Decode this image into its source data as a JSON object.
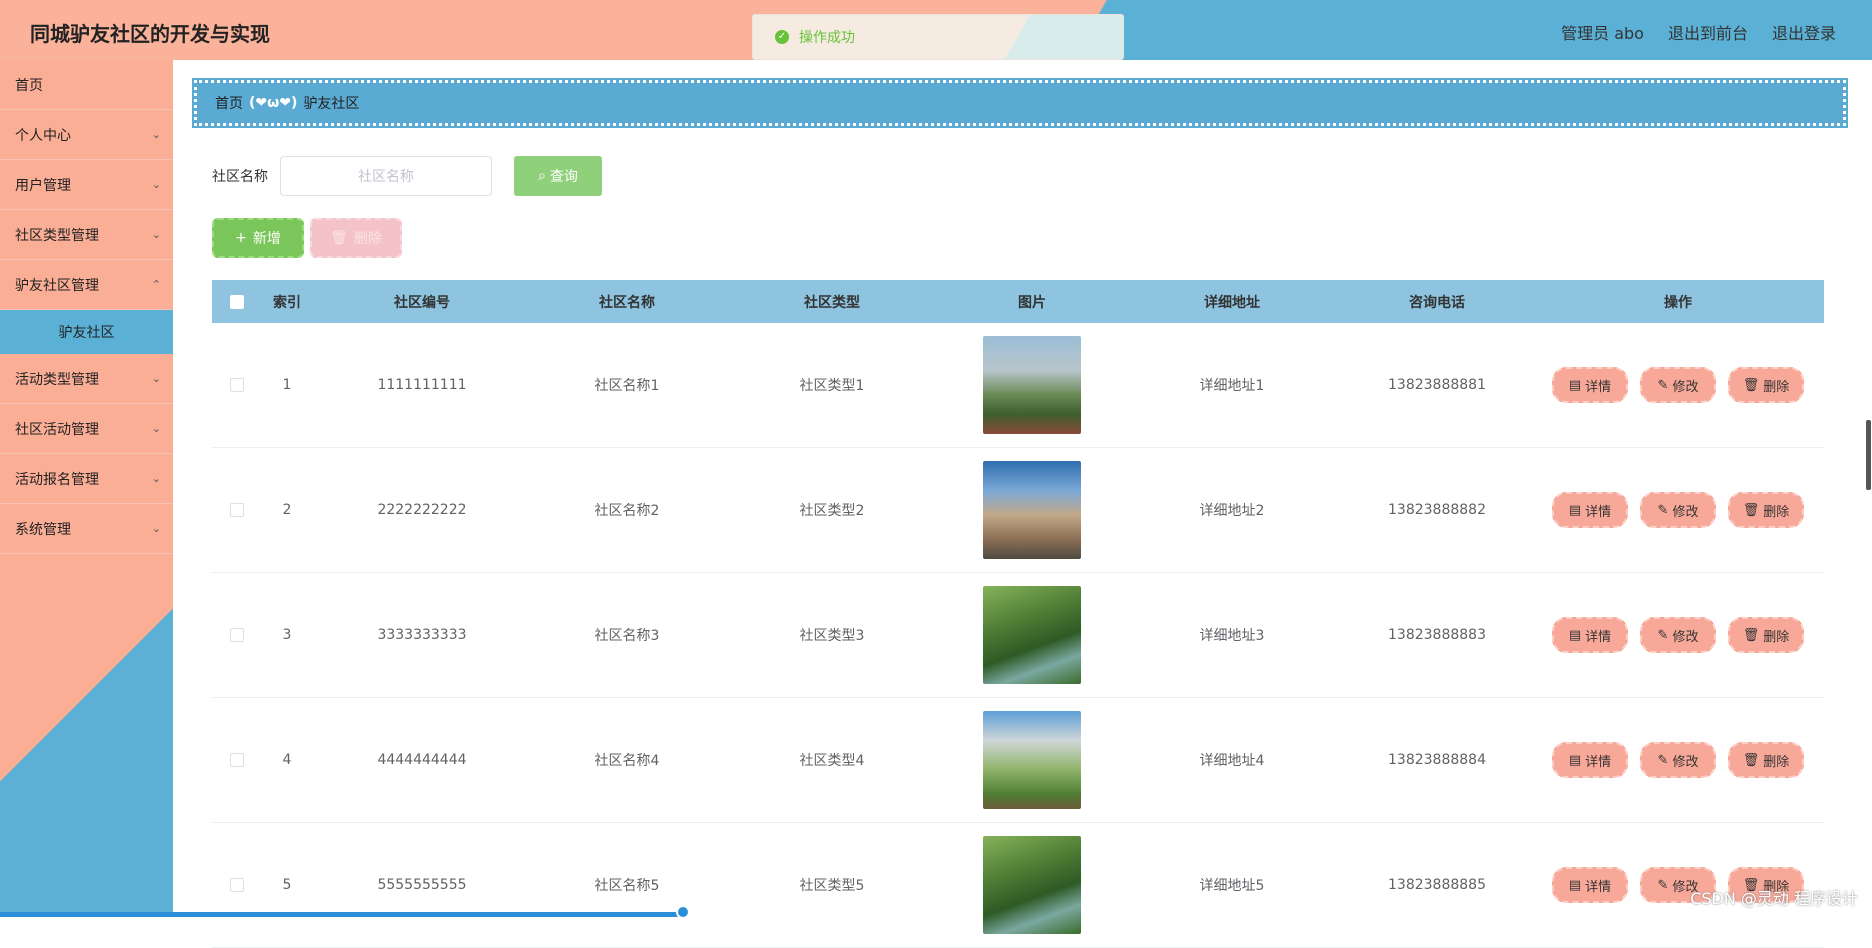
{
  "header": {
    "title": "同城驴友社区的开发与实现",
    "user": "管理员 abo",
    "to_front": "退出到前台",
    "logout": "退出登录"
  },
  "toast": {
    "message": "操作成功"
  },
  "sidebar": {
    "items": [
      {
        "label": "首页"
      },
      {
        "label": "个人中心"
      },
      {
        "label": "用户管理"
      },
      {
        "label": "社区类型管理"
      },
      {
        "label": "驴友社区管理"
      },
      {
        "label": "活动类型管理"
      },
      {
        "label": "社区活动管理"
      },
      {
        "label": "活动报名管理"
      },
      {
        "label": "系统管理"
      }
    ],
    "sub_active": "驴友社区"
  },
  "breadcrumb": {
    "home": "首页",
    "sep": "(❤ω❤)",
    "current": "驴友社区"
  },
  "search": {
    "label": "社区名称",
    "placeholder": "社区名称",
    "button": "查询"
  },
  "actions": {
    "add": "新增",
    "delete": "删除"
  },
  "table": {
    "headers": [
      "索引",
      "社区编号",
      "社区名称",
      "社区类型",
      "图片",
      "详细地址",
      "咨询电话",
      "操作"
    ],
    "op_labels": {
      "detail": "详情",
      "edit": "修改",
      "delete": "删除"
    },
    "rows": [
      {
        "idx": "1",
        "num": "1111111111",
        "name": "社区名称1",
        "type": "社区类型1",
        "addr": "详细地址1",
        "tel": "13823888881",
        "img": "park-buildings"
      },
      {
        "idx": "2",
        "num": "2222222222",
        "name": "社区名称2",
        "type": "社区类型2",
        "addr": "详细地址2",
        "tel": "13823888882",
        "img": "apartment-towers"
      },
      {
        "idx": "3",
        "num": "3333333333",
        "name": "社区名称3",
        "type": "社区类型3",
        "addr": "详细地址3",
        "tel": "13823888883",
        "img": "green-garden"
      },
      {
        "idx": "4",
        "num": "4444444444",
        "name": "社区名称4",
        "type": "社区类型4",
        "addr": "详细地址4",
        "tel": "13823888884",
        "img": "garden-tower"
      },
      {
        "idx": "5",
        "num": "5555555555",
        "name": "社区名称5",
        "type": "社区类型5",
        "addr": "详细地址5",
        "tel": "13823888885",
        "img": "green-garden"
      }
    ]
  },
  "watermark": "CSDN @灵动 程序设计",
  "colors": {
    "salmon": "#fbb29a",
    "blue": "#5bb0d6",
    "green": "#7ac65a",
    "pink": "#f8a898"
  }
}
